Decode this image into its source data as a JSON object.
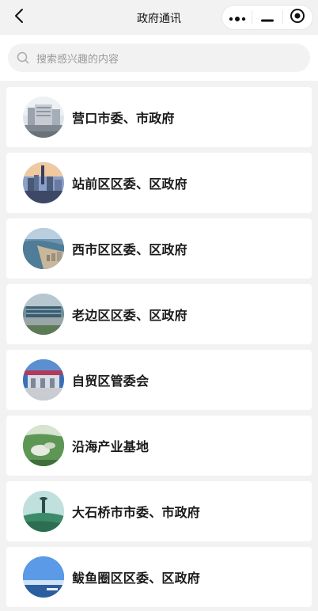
{
  "header": {
    "title": "政府通讯",
    "back_icon": "chevron-left-icon",
    "capsule": {
      "more_icon": "more-dots-icon",
      "minimize_icon": "minimize-icon",
      "close_icon": "target-circle-icon"
    }
  },
  "search": {
    "placeholder": "搜索感兴趣的内容",
    "icon": "search-icon"
  },
  "items": [
    {
      "label": "营口市委、市政府"
    },
    {
      "label": "站前区区委、区政府"
    },
    {
      "label": "西市区区委、区政府"
    },
    {
      "label": "老边区区委、区政府"
    },
    {
      "label": "自贸区管委会"
    },
    {
      "label": "沿海产业基地"
    },
    {
      "label": "大石桥市市委、市政府"
    },
    {
      "label": "鲅鱼圈区区委、区政府"
    }
  ],
  "colors": {
    "background": "#f2f2f2",
    "card": "#ffffff",
    "text": "#1a1a1a",
    "placeholder": "#9a9a9a"
  }
}
